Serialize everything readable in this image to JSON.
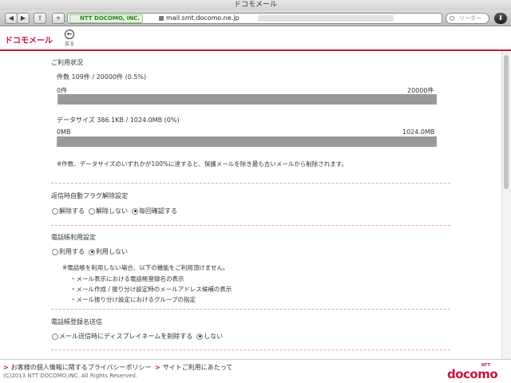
{
  "window": {
    "title": "ドコモメール"
  },
  "toolbar": {
    "back_glyph": "◀",
    "forward_glyph": "▶",
    "share_glyph": "⇪",
    "add_glyph": "+",
    "ev_label": "NTT DOCOMO, INC.",
    "url": "mail.smt.docomo.ne.jp",
    "reader_label": "リーダー",
    "search_placeholder": "",
    "download_glyph": "⬇"
  },
  "header": {
    "logo": "ドコモメール",
    "back_glyph": "←",
    "back_label": "戻る"
  },
  "usage": {
    "title": "ご利用状況",
    "count_line": "件数 109件 / 20000件 (0.5%)",
    "count_min": "0件",
    "count_max": "20000件",
    "count_fraction": 0.005,
    "size_line": "データサイズ 386.1KB / 1024.0MB (0%)",
    "size_min": "0MB",
    "size_max": "1024.0MB",
    "size_fraction": 0.0,
    "note": "※件数、データサイズのいずれかが100%に達すると、保護メールを除き最も古いメールから削除されます。"
  },
  "reply_flag": {
    "title": "返信時自動フラグ解除設定",
    "options": [
      "解除する",
      "解除しない",
      "毎回確認する"
    ],
    "selected": 2
  },
  "phonebook": {
    "title": "電話帳利用設定",
    "options": [
      "利用する",
      "利用しない"
    ],
    "selected": 1,
    "note": "※電話帳を利用しない場合、以下の機能をご利用頂けません。",
    "bullets": [
      "・メール表示における電話帳登録名の表示",
      "・メール作成 / 振り分け設定時のメールアドレス候補の表示",
      "・メール振り分け設定におけるグループの指定"
    ]
  },
  "phonebook_send": {
    "title": "電話帳登録名送信",
    "options": [
      "メール送信時にディスプレイネームを削除する",
      "しない"
    ],
    "selected": 1
  },
  "footer": {
    "link1": "お客様の個人情報に関するプライバシーポリシー",
    "link2": "サイトご利用にあたって",
    "arrow": ">",
    "copyright": "(C)2013 NTT DOCOMO,INC. All Rights Reserved.",
    "brand_small": "NTT",
    "brand": "docomo"
  },
  "colors": {
    "accent": "#c8143a",
    "bar": "#999999"
  }
}
